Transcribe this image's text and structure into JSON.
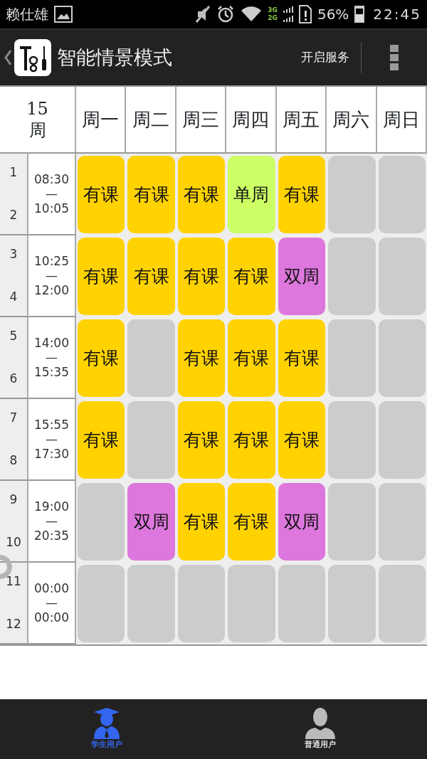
{
  "status_bar": {
    "user": "赖仕雄",
    "network_top": "3G",
    "network_bottom": "2G",
    "battery_text": "56%",
    "time": "22:45"
  },
  "app_bar": {
    "title": "智能情景模式",
    "action": "开启服务"
  },
  "timetable": {
    "week_number": "15",
    "week_unit": "周",
    "days": [
      "周一",
      "周二",
      "周三",
      "周四",
      "周五",
      "周六",
      "周日"
    ],
    "rows": [
      {
        "period_start": "1",
        "period_end": "2",
        "time_start": "08:30",
        "dash": "—",
        "time_end": "10:05",
        "cells": [
          {
            "text": "有课",
            "color": "#ffd200"
          },
          {
            "text": "有课",
            "color": "#ffd200"
          },
          {
            "text": "有课",
            "color": "#ffd200"
          },
          {
            "text": "单周",
            "color": "#ccff66"
          },
          {
            "text": "有课",
            "color": "#ffd200"
          },
          {
            "color": "#cccccc"
          },
          {
            "color": "#cccccc"
          }
        ]
      },
      {
        "period_start": "3",
        "period_end": "4",
        "time_start": "10:25",
        "dash": "—",
        "time_end": "12:00",
        "cells": [
          {
            "text": "有课",
            "color": "#ffd200"
          },
          {
            "text": "有课",
            "color": "#ffd200"
          },
          {
            "text": "有课",
            "color": "#ffd200"
          },
          {
            "text": "有课",
            "color": "#ffd200"
          },
          {
            "text": "双周",
            "color": "#dd77dd"
          },
          {
            "color": "#cccccc"
          },
          {
            "color": "#cccccc"
          }
        ]
      },
      {
        "period_start": "5",
        "period_end": "6",
        "time_start": "14:00",
        "dash": "—",
        "time_end": "15:35",
        "cells": [
          {
            "text": "有课",
            "color": "#ffd200"
          },
          {
            "color": "#cccccc"
          },
          {
            "text": "有课",
            "color": "#ffd200"
          },
          {
            "text": "有课",
            "color": "#ffd200"
          },
          {
            "text": "有课",
            "color": "#ffd200"
          },
          {
            "color": "#cccccc"
          },
          {
            "color": "#cccccc"
          }
        ]
      },
      {
        "period_start": "7",
        "period_end": "8",
        "time_start": "15:55",
        "dash": "—",
        "time_end": "17:30",
        "cells": [
          {
            "text": "有课",
            "color": "#ffd200"
          },
          {
            "color": "#cccccc"
          },
          {
            "text": "有课",
            "color": "#ffd200"
          },
          {
            "text": "有课",
            "color": "#ffd200"
          },
          {
            "text": "有课",
            "color": "#ffd200"
          },
          {
            "color": "#cccccc"
          },
          {
            "color": "#cccccc"
          }
        ]
      },
      {
        "period_start": "9",
        "period_end": "10",
        "time_start": "19:00",
        "dash": "—",
        "time_end": "20:35",
        "cells": [
          {
            "color": "#cccccc"
          },
          {
            "text": "双周",
            "color": "#dd77dd"
          },
          {
            "text": "有课",
            "color": "#ffd200"
          },
          {
            "text": "有课",
            "color": "#ffd200"
          },
          {
            "text": "双周",
            "color": "#dd77dd"
          },
          {
            "color": "#cccccc"
          },
          {
            "color": "#cccccc"
          }
        ]
      },
      {
        "period_start": "11",
        "period_end": "12",
        "time_start": "00:00",
        "dash": "—",
        "time_end": "00:00",
        "cells": [
          {
            "color": "#cccccc"
          },
          {
            "color": "#cccccc"
          },
          {
            "color": "#cccccc"
          },
          {
            "color": "#cccccc"
          },
          {
            "color": "#cccccc"
          },
          {
            "color": "#cccccc"
          },
          {
            "color": "#cccccc"
          }
        ]
      }
    ]
  },
  "bottom_nav": [
    {
      "label": "学生用户",
      "kind": "student",
      "selected": true
    },
    {
      "label": "普通用户",
      "kind": "user",
      "selected": false
    }
  ]
}
